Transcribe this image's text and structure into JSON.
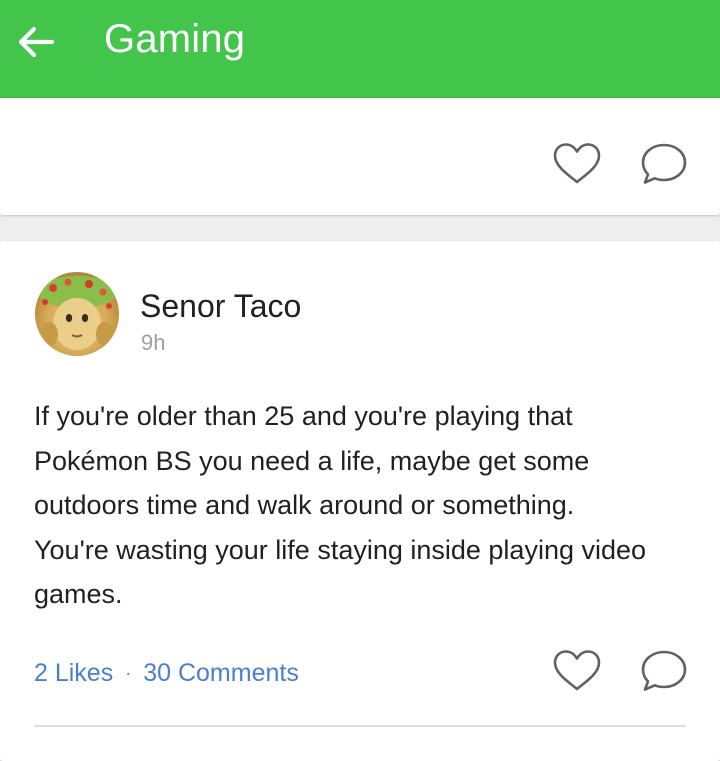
{
  "header": {
    "title": "Gaming",
    "back_icon": "arrow-left-icon",
    "background_color": "#43c44b"
  },
  "previous_post": {
    "actions": {
      "like_icon": "heart-outline-icon",
      "comment_icon": "speech-bubble-icon"
    }
  },
  "post": {
    "author": "Senor Taco",
    "time": "9h",
    "body": "If you're older than 25 and you're playing that Pokémon BS you need a life, maybe get some outdoors time and walk around or something. You're wasting your life staying inside playing video games.",
    "likes_label": "2 Likes",
    "separator": "·",
    "comments_label": "30 Comments",
    "like_icon": "heart-outline-icon",
    "comment_icon": "speech-bubble-icon",
    "link_color": "#4a7fd0"
  }
}
